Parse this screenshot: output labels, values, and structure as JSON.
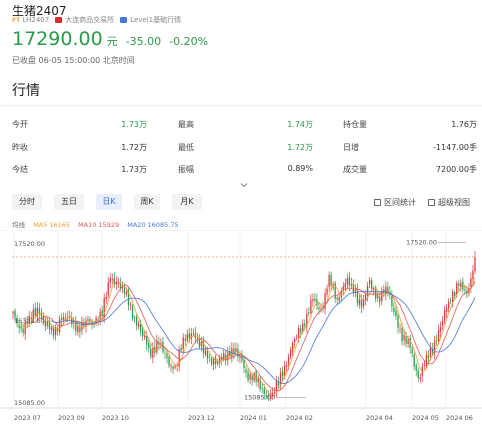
{
  "header": {
    "title": "生猪2407",
    "code_tag": "FT",
    "code": "LH2407",
    "exchange": "大连商品交易所",
    "level": "Level1基础行情"
  },
  "price": {
    "last": "17290.00",
    "unit": "元",
    "change": "-35.00",
    "change_pct": "-0.20%",
    "status": "已收盘 06-05 15:00:00 北京时间"
  },
  "section_title": "行情",
  "stats": [
    {
      "label": "今开",
      "value": "1.73万",
      "tone": "green"
    },
    {
      "label": "最高",
      "value": "1.74万",
      "tone": "green"
    },
    {
      "label": "持仓量",
      "value": "1.76万",
      "tone": "gray"
    },
    {
      "label": "昨收",
      "value": "1.72万",
      "tone": "gray"
    },
    {
      "label": "最低",
      "value": "1.72万",
      "tone": "green"
    },
    {
      "label": "日增",
      "value": "-1147.00手",
      "tone": "gray"
    },
    {
      "label": "今结",
      "value": "1.73万",
      "tone": "gray"
    },
    {
      "label": "振幅",
      "value": "0.89%",
      "tone": "gray"
    },
    {
      "label": "成交量",
      "value": "7200.00手",
      "tone": "gray"
    }
  ],
  "tabs": [
    "分时",
    "五日",
    "日K",
    "周K",
    "月K"
  ],
  "active_tab": "日K",
  "tools": {
    "range": "区间统计",
    "fullscreen": "超级视图"
  },
  "ma": {
    "label": "均线",
    "ma5": "MA5 16165",
    "ma10": "MA10 15929",
    "ma20": "MA20 16085.75"
  },
  "colors": {
    "down": "#2a9b49",
    "up": "#e0393b",
    "ma5": "#f0a030",
    "ma10": "#e05a5a",
    "ma20": "#4a76d6",
    "active_tab": "#3b6fd4"
  },
  "chart_data": {
    "type": "candlestick",
    "y_ticks": [
      "17520.00",
      "16302.50",
      "15085.00"
    ],
    "x_ticks": [
      "2023 07",
      "2023 09",
      "2023 10",
      "2023 12",
      "2024 01",
      "2024 02",
      "2024 04",
      "2024 05",
      "2024 06"
    ],
    "max_label": "17520.00",
    "min_label": "15085.00",
    "last_price": 17290,
    "ylim": [
      14950,
      17650
    ],
    "close_path": [
      16380,
      16150,
      16280,
      16500,
      16250,
      16080,
      16350,
      16280,
      16180,
      16250,
      16300,
      16420,
      16950,
      16880,
      16650,
      16350,
      16050,
      15800,
      15950,
      15650,
      15550,
      15950,
      16150,
      15900,
      15750,
      15600,
      15700,
      15850,
      15700,
      15450,
      15350,
      15150,
      15100,
      15400,
      15750,
      16050,
      16300,
      16600,
      16450,
      16950,
      16600,
      16950,
      16750,
      16550,
      16850,
      16650,
      16800,
      16450,
      16050,
      15850,
      15400,
      15650,
      15950,
      16300,
      16650,
      16900,
      16650,
      17290
    ]
  }
}
